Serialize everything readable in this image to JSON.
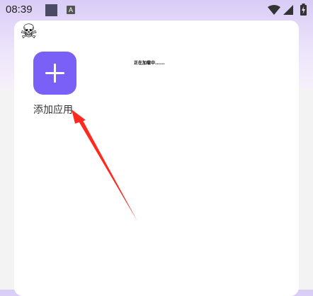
{
  "status_bar": {
    "time": "08:39",
    "notification_icon": "a-badge-icon"
  },
  "header": {
    "logo_glyph": "☠"
  },
  "apps": {
    "add_label": "添加应用"
  },
  "loading_text": "正在加载中......",
  "colors": {
    "accent": "#7a60f6",
    "annotation_arrow": "#ff2a1f"
  }
}
